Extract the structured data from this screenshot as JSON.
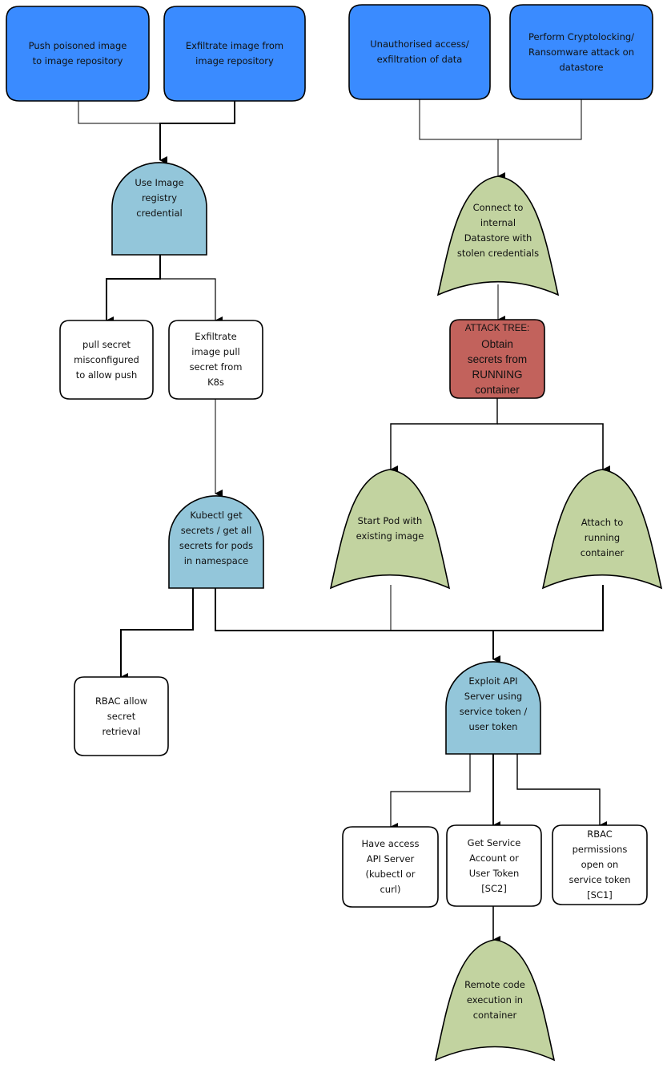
{
  "diagram": {
    "title": "Attack tree: Obtain secrets from RUNNING container",
    "colors": {
      "goal_fill": "#3a8bff",
      "and_gate_fill": "#93c6da",
      "or_gate_fill": "#c2d3a0",
      "root_fill": "#c2625c",
      "leaf_fill": "#ffffff",
      "stroke": "#000000"
    },
    "nodes": {
      "push_poisoned": {
        "type": "goal",
        "lines": [
          "Push poisoned image",
          "to image repository"
        ]
      },
      "exfil_image": {
        "type": "goal",
        "lines": [
          "Exfiltrate image from",
          "image repository"
        ]
      },
      "unauth_access": {
        "type": "goal",
        "lines": [
          "Unauthorised access/",
          "exfiltration of data"
        ]
      },
      "cryptolocking": {
        "type": "goal",
        "lines": [
          "Perform Cryptolocking/",
          "Ransomware attack on",
          "datastore"
        ]
      },
      "use_registry_cred": {
        "type": "and-gate",
        "lines": [
          "Use Image",
          "registry",
          "credential"
        ]
      },
      "connect_datastore": {
        "type": "or-gate",
        "lines": [
          "Connect to",
          "internal",
          "Datastore with",
          "stolen credentials"
        ]
      },
      "pull_secret_misconfig": {
        "type": "leaf",
        "lines": [
          "pull secret",
          "misconfigured",
          "to allow push"
        ]
      },
      "exfil_pull_secret": {
        "type": "leaf",
        "lines": [
          "Exfiltrate",
          "image pull",
          "secret from",
          "K8s"
        ]
      },
      "attack_tree_root": {
        "type": "root",
        "lines": [
          "ATTACK TREE:",
          "Obtain",
          "secrets from",
          "RUNNING",
          "container"
        ]
      },
      "start_pod": {
        "type": "or-gate",
        "lines": [
          "Start Pod with",
          "existing image"
        ]
      },
      "attach_container": {
        "type": "or-gate",
        "lines": [
          "Attach to",
          "running",
          "container"
        ]
      },
      "kubectl_get_secrets": {
        "type": "and-gate",
        "lines": [
          "Kubectl get",
          "secrets / get all",
          "secrets for pods",
          "in namespace"
        ]
      },
      "rbac_allow_secret": {
        "type": "leaf",
        "lines": [
          "RBAC allow",
          "secret",
          "retrieval"
        ]
      },
      "exploit_api_server": {
        "type": "and-gate",
        "lines": [
          "Exploit API",
          "Server using",
          "service token /",
          "user token"
        ]
      },
      "have_access_api": {
        "type": "leaf",
        "lines": [
          "Have access",
          "API Server",
          "(kubectl or",
          "curl)"
        ]
      },
      "get_service_account": {
        "type": "leaf",
        "lines": [
          "Get Service",
          "Account or",
          "User Token",
          "[SC2]"
        ]
      },
      "rbac_permissions_open": {
        "type": "leaf",
        "lines": [
          "RBAC",
          "permissions",
          "open on",
          "service token",
          "[SC1]"
        ]
      },
      "remote_code_exec": {
        "type": "or-gate",
        "lines": [
          "Remote code",
          "execution in",
          "container"
        ]
      }
    },
    "edges": [
      {
        "from": "push_poisoned",
        "to": "use_registry_cred"
      },
      {
        "from": "exfil_image",
        "to": "use_registry_cred"
      },
      {
        "from": "unauth_access",
        "to": "connect_datastore"
      },
      {
        "from": "cryptolocking",
        "to": "connect_datastore"
      },
      {
        "from": "use_registry_cred",
        "to": "pull_secret_misconfig"
      },
      {
        "from": "use_registry_cred",
        "to": "exfil_pull_secret"
      },
      {
        "from": "connect_datastore",
        "to": "attack_tree_root"
      },
      {
        "from": "exfil_pull_secret",
        "to": "kubectl_get_secrets"
      },
      {
        "from": "attack_tree_root",
        "to": "start_pod"
      },
      {
        "from": "attack_tree_root",
        "to": "attach_container"
      },
      {
        "from": "kubectl_get_secrets",
        "to": "rbac_allow_secret"
      },
      {
        "from": "kubectl_get_secrets",
        "to": "exploit_api_server"
      },
      {
        "from": "start_pod",
        "to": "exploit_api_server"
      },
      {
        "from": "attach_container",
        "to": "exploit_api_server"
      },
      {
        "from": "exploit_api_server",
        "to": "have_access_api"
      },
      {
        "from": "exploit_api_server",
        "to": "get_service_account"
      },
      {
        "from": "exploit_api_server",
        "to": "rbac_permissions_open"
      },
      {
        "from": "get_service_account",
        "to": "remote_code_exec"
      }
    ]
  }
}
